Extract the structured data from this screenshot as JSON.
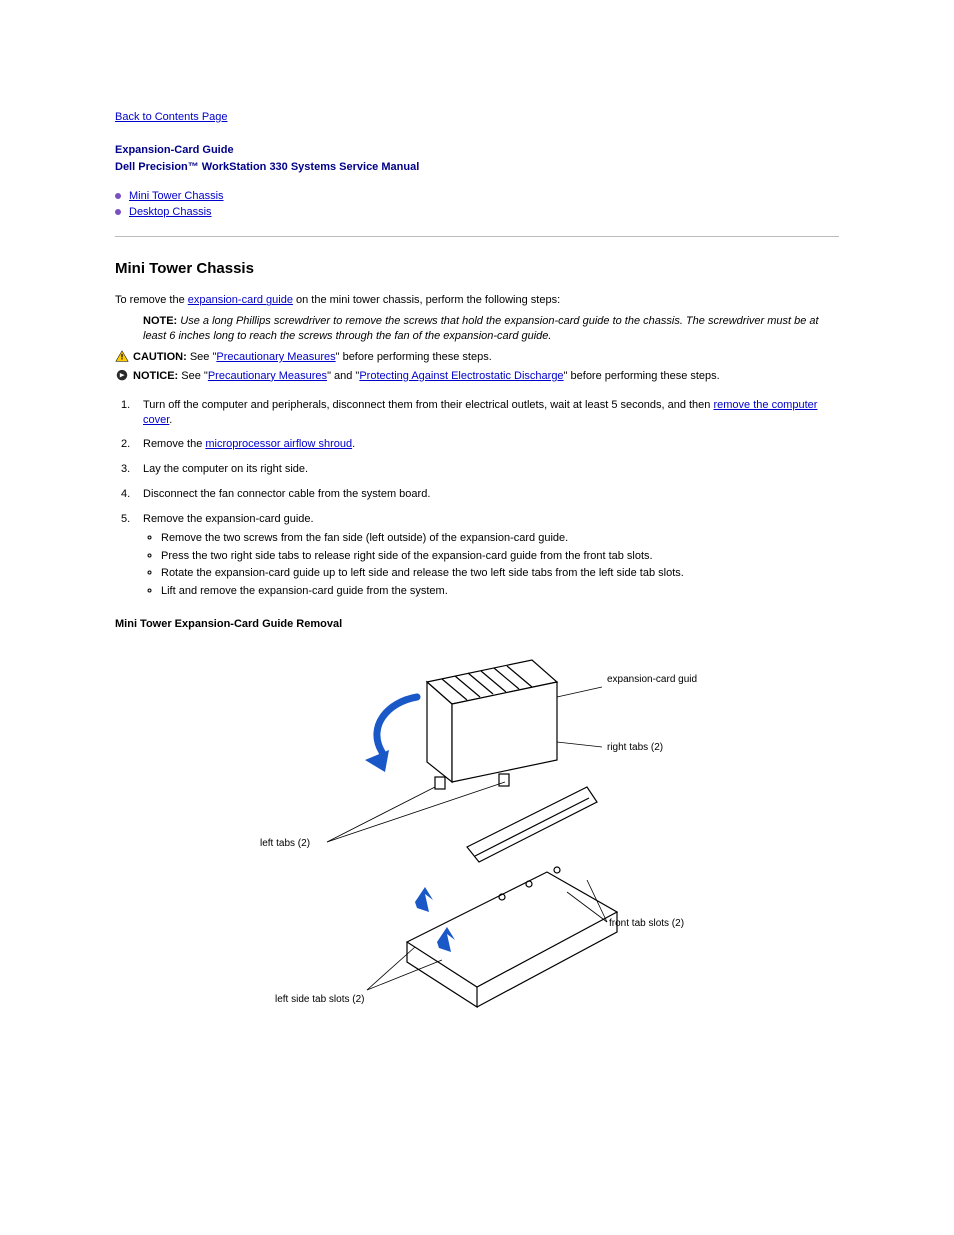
{
  "nav": {
    "back": "Back to Contents Page"
  },
  "title": "Expansion-Card Guide",
  "subtitle": "Dell Precision™ WorkStation 330 Systems Service Manual",
  "toc": {
    "item1": "Mini Tower Chassis",
    "item2": "Desktop Chassis"
  },
  "section1": {
    "heading": "Mini Tower Chassis",
    "intro_prefix": "To remove the ",
    "intro_link": "expansion-card guide",
    "intro_suffix": " on the mini tower chassis, perform the following steps:",
    "note_label": "NOTE:",
    "note_text": "Use a long Phillips screwdriver to remove the screws that hold the expansion-card guide to the chassis. The screwdriver must be at least 6 inches long to reach the screws through the fan of the expansion-card guide.",
    "caution_label": "CAUTION:",
    "caution_link": "Precautionary Measures",
    "caution_suffix": "\" before performing these steps.",
    "caution_prefix": " See \"",
    "notice_label": "NOTICE:",
    "notice_prefix": " See \"",
    "notice_link1": "Precautionary Measures",
    "notice_mid": "\" and \"",
    "notice_link2": "Protecting Against Electrostatic Discharge",
    "notice_suffix": "\" before performing these steps.",
    "steps": {
      "s1_prefix": "Turn off the computer and peripherals, disconnect them from their electrical outlets, wait at least 5 seconds, and then ",
      "s1_link": "remove the computer cover",
      "s1_suffix": ".",
      "s2_prefix": "Remove the ",
      "s2_link": "microprocessor airflow shroud",
      "s2_suffix": ".",
      "s3": "Lay the computer on its right side.",
      "s4": "Disconnect the fan connector cable from the system board.",
      "s5_main": "Remove the expansion-card guide.",
      "s5_a": "Remove the two screws from the fan side (left outside) of the expansion-card guide.",
      "s5_b": "Press the two right side tabs to release right side of the expansion-card guide from the front tab slots.",
      "s5_c": "Rotate the expansion-card guide up to left side and release the two left side tabs from the left side tab slots.",
      "s5_d": "Lift and remove the expansion-card guide from the system."
    },
    "figure_caption": "Mini Tower Expansion-Card Guide Removal",
    "labels": {
      "guide": "expansion-card guide",
      "right_tabs": "right tabs (2)",
      "left_tabs": "left tabs (2)",
      "front_slots": "front tab slots (2)",
      "left_slots": "left side tab slots (2)"
    }
  }
}
